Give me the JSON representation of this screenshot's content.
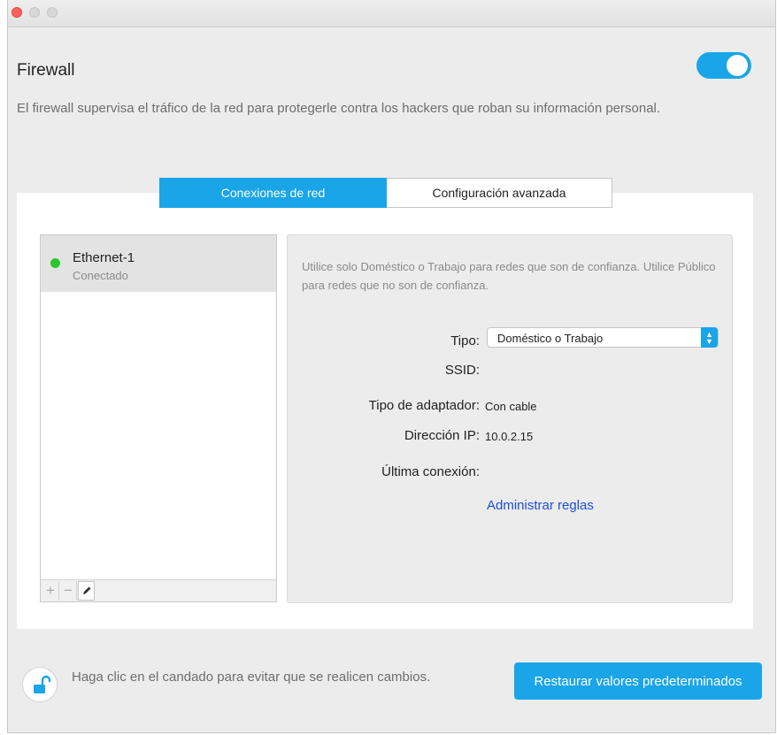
{
  "header": {
    "title": "Firewall",
    "toggle_on": true,
    "description": "El firewall supervisa el tráfico de la red para protegerle contra los hackers que roban su información personal."
  },
  "tabs": [
    {
      "label": "Conexiones de red",
      "active": true
    },
    {
      "label": "Configuración avanzada",
      "active": false
    }
  ],
  "networks": [
    {
      "name": "Ethernet-1",
      "status": "Conectado",
      "status_color": "#2dc52d"
    }
  ],
  "list_toolbar": {
    "add_icon": "plus-icon",
    "remove_icon": "minus-icon",
    "edit_icon": "pencil-icon"
  },
  "details": {
    "note": "Utilice solo Doméstico o Trabajo para redes que son de confianza. Utilice Público para redes que no son de confianza.",
    "type_label": "Tipo:",
    "type_value": "Doméstico o Trabajo",
    "ssid_label": "SSID:",
    "ssid_value": "",
    "adapter_label": "Tipo de adaptador:",
    "adapter_value": "Con cable",
    "ip_label": "Dirección IP:",
    "ip_value": "10.0.2.15",
    "last_conn_label": "Última conexión:",
    "last_conn_value": "",
    "manage_rules": "Administrar reglas"
  },
  "footer": {
    "lock_hint": "Haga clic en el candado para evitar que se realicen cambios.",
    "restore_button": "Restaurar valores predeterminados"
  },
  "colors": {
    "accent": "#1aa5e8",
    "link": "#1f4fd8"
  }
}
